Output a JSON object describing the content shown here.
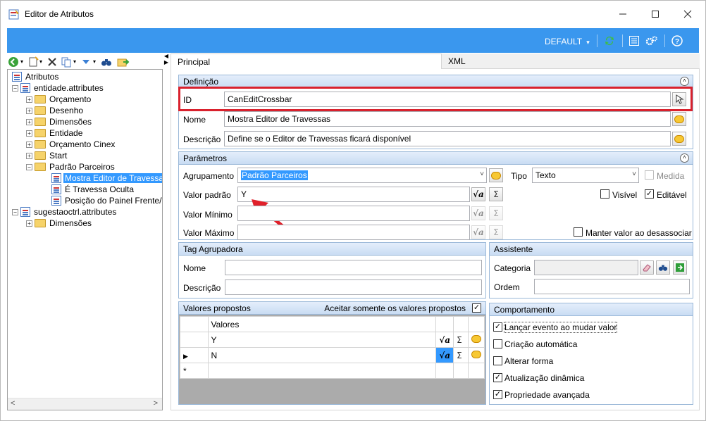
{
  "window": {
    "title": "Editor de Atributos"
  },
  "header": {
    "profile": "DEFAULT"
  },
  "tree": {
    "root": "Atributos",
    "nodes": [
      "entidade.attributes",
      "Orçamento",
      "Desenho",
      "Dimensões",
      "Entidade",
      "Orçamento Cinex",
      "Start",
      "Padrão Parceiros",
      "Mostra Editor de Travessas",
      "É Travessa Oculta",
      "Posição do Painel Frente/Tr",
      "sugestaoctrl.attributes",
      "Dimensões"
    ]
  },
  "tabs": [
    "Principal",
    "XML"
  ],
  "definicao": {
    "title": "Definição",
    "id_label": "ID",
    "id_value": "CanEditCrossbar",
    "nome_label": "Nome",
    "nome_value": "Mostra Editor de Travessas",
    "descricao_label": "Descrição",
    "descricao_value": "Define se o Editor de Travessas ficará disponível"
  },
  "parametros": {
    "title": "Parâmetros",
    "agrupamento_label": "Agrupamento",
    "agrupamento_value": "Padrão Parceiros",
    "tipo_label": "Tipo",
    "tipo_value": "Texto",
    "medida_label": "Medida",
    "valor_padrao_label": "Valor padrão",
    "valor_padrao_value": "Y",
    "visivel_label": "Visível",
    "editavel_label": "Editável",
    "valor_minimo_label": "Valor Mínimo",
    "valor_maximo_label": "Valor Máximo",
    "manter_label": "Manter valor ao desassociar"
  },
  "tag": {
    "title": "Tag Agrupadora",
    "nome_label": "Nome",
    "descricao_label": "Descrição"
  },
  "assistente": {
    "title": "Assistente",
    "categoria_label": "Categoria",
    "ordem_label": "Ordem"
  },
  "valores": {
    "title": "Valores propostos",
    "aceitar_label": "Aceitar somente os valores propostos",
    "col_header": "Valores",
    "rows": [
      "Y",
      "N"
    ],
    "new_marker": "*"
  },
  "comportamento": {
    "title": "Comportamento",
    "items": [
      {
        "label": "Lançar evento ao mudar valor",
        "checked": "✓"
      },
      {
        "label": "Criação automática",
        "checked": ""
      },
      {
        "label": "Alterar forma",
        "checked": ""
      },
      {
        "label": "Atualização dinâmica",
        "checked": "✓"
      },
      {
        "label": "Propriedade avançada",
        "checked": "✓"
      }
    ]
  },
  "glyphs": {
    "check": "✓",
    "sigma": "Σ",
    "sqrt": "√a",
    "up": "˄",
    "down": "˅"
  },
  "colors": {
    "accent": "#3a97ee",
    "highlight": "#d9212d",
    "selection": "#3399ff"
  }
}
